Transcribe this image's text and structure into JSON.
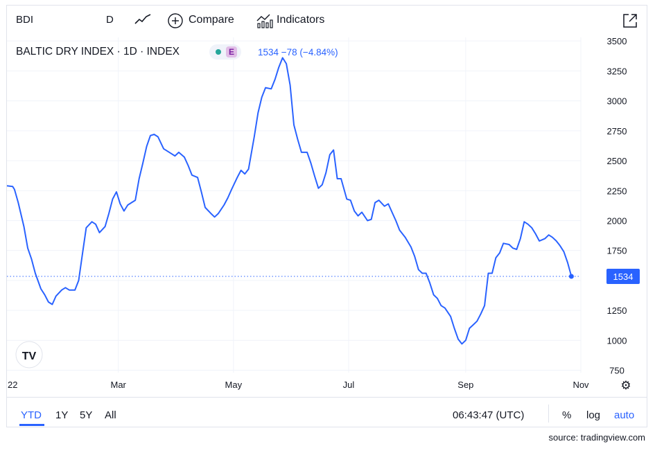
{
  "toolbar": {
    "symbol": "BDI",
    "interval": "D",
    "compare_label": "Compare",
    "indicators_label": "Indicators"
  },
  "legend": {
    "title": "BALTIC DRY INDEX · 1D · INDEX",
    "badge_letter": "E",
    "quote": "1534 −78 (−4.84%)"
  },
  "chart_data": {
    "type": "line",
    "title": "BALTIC DRY INDEX · 1D · INDEX",
    "xlabel": "",
    "ylabel": "",
    "ylim": [
      730,
      3530
    ],
    "y_ticks": [
      750,
      1000,
      1250,
      1500,
      1750,
      2000,
      2250,
      2500,
      2750,
      3000,
      3250,
      3500
    ],
    "x_tick_labels": [
      "22",
      "Mar",
      "May",
      "Jul",
      "Sep",
      "Nov"
    ],
    "x_tick_dates": [
      "2022-01-01",
      "2022-03-01",
      "2022-05-01",
      "2022-07-01",
      "2022-09-01",
      "2022-11-01"
    ],
    "x_range": [
      "2022-01-01",
      "2022-11-01"
    ],
    "last_value_label": "1534",
    "last_value": 1534,
    "color": "#2962ff",
    "grid": true,
    "series": [
      {
        "points": [
          [
            "2022-01-01",
            2290
          ],
          [
            "2022-01-04",
            2285
          ],
          [
            "2022-01-05",
            2260
          ],
          [
            "2022-01-07",
            2150
          ],
          [
            "2022-01-10",
            1950
          ],
          [
            "2022-01-12",
            1770
          ],
          [
            "2022-01-14",
            1680
          ],
          [
            "2022-01-16",
            1560
          ],
          [
            "2022-01-19",
            1430
          ],
          [
            "2022-01-21",
            1380
          ],
          [
            "2022-01-23",
            1320
          ],
          [
            "2022-01-25",
            1300
          ],
          [
            "2022-01-27",
            1370
          ],
          [
            "2022-01-30",
            1420
          ],
          [
            "2022-02-01",
            1440
          ],
          [
            "2022-02-03",
            1420
          ],
          [
            "2022-02-06",
            1420
          ],
          [
            "2022-02-08",
            1500
          ],
          [
            "2022-02-10",
            1720
          ],
          [
            "2022-02-12",
            1940
          ],
          [
            "2022-02-15",
            1990
          ],
          [
            "2022-02-17",
            1970
          ],
          [
            "2022-02-19",
            1900
          ],
          [
            "2022-02-22",
            1950
          ],
          [
            "2022-02-24",
            2060
          ],
          [
            "2022-02-26",
            2180
          ],
          [
            "2022-02-28",
            2240
          ],
          [
            "2022-03-02",
            2140
          ],
          [
            "2022-03-04",
            2080
          ],
          [
            "2022-03-06",
            2130
          ],
          [
            "2022-03-08",
            2150
          ],
          [
            "2022-03-10",
            2170
          ],
          [
            "2022-03-12",
            2350
          ],
          [
            "2022-03-14",
            2480
          ],
          [
            "2022-03-16",
            2620
          ],
          [
            "2022-03-18",
            2710
          ],
          [
            "2022-03-20",
            2720
          ],
          [
            "2022-03-22",
            2700
          ],
          [
            "2022-03-25",
            2600
          ],
          [
            "2022-03-27",
            2580
          ],
          [
            "2022-03-29",
            2560
          ],
          [
            "2022-03-31",
            2540
          ],
          [
            "2022-04-02",
            2570
          ],
          [
            "2022-04-05",
            2530
          ],
          [
            "2022-04-07",
            2460
          ],
          [
            "2022-04-09",
            2380
          ],
          [
            "2022-04-12",
            2360
          ],
          [
            "2022-04-14",
            2240
          ],
          [
            "2022-04-16",
            2110
          ],
          [
            "2022-04-19",
            2060
          ],
          [
            "2022-04-21",
            2030
          ],
          [
            "2022-04-23",
            2060
          ],
          [
            "2022-04-26",
            2130
          ],
          [
            "2022-04-28",
            2190
          ],
          [
            "2022-04-30",
            2260
          ],
          [
            "2022-05-03",
            2360
          ],
          [
            "2022-05-05",
            2420
          ],
          [
            "2022-05-07",
            2390
          ],
          [
            "2022-05-09",
            2430
          ],
          [
            "2022-05-12",
            2700
          ],
          [
            "2022-05-14",
            2900
          ],
          [
            "2022-05-16",
            3030
          ],
          [
            "2022-05-18",
            3110
          ],
          [
            "2022-05-21",
            3100
          ],
          [
            "2022-05-23",
            3180
          ],
          [
            "2022-05-25",
            3280
          ],
          [
            "2022-05-27",
            3360
          ],
          [
            "2022-05-29",
            3310
          ],
          [
            "2022-05-31",
            3130
          ],
          [
            "2022-06-02",
            2800
          ],
          [
            "2022-06-04",
            2680
          ],
          [
            "2022-06-06",
            2570
          ],
          [
            "2022-06-09",
            2570
          ],
          [
            "2022-06-11",
            2480
          ],
          [
            "2022-06-13",
            2370
          ],
          [
            "2022-06-15",
            2270
          ],
          [
            "2022-06-17",
            2300
          ],
          [
            "2022-06-19",
            2400
          ],
          [
            "2022-06-21",
            2550
          ],
          [
            "2022-06-23",
            2590
          ],
          [
            "2022-06-25",
            2350
          ],
          [
            "2022-06-27",
            2350
          ],
          [
            "2022-06-30",
            2180
          ],
          [
            "2022-07-02",
            2170
          ],
          [
            "2022-07-04",
            2080
          ],
          [
            "2022-07-06",
            2040
          ],
          [
            "2022-07-08",
            2070
          ],
          [
            "2022-07-11",
            2000
          ],
          [
            "2022-07-13",
            2010
          ],
          [
            "2022-07-15",
            2150
          ],
          [
            "2022-07-17",
            2170
          ],
          [
            "2022-07-20",
            2120
          ],
          [
            "2022-07-22",
            2140
          ],
          [
            "2022-07-24",
            2070
          ],
          [
            "2022-07-26",
            2000
          ],
          [
            "2022-07-28",
            1920
          ],
          [
            "2022-07-31",
            1860
          ],
          [
            "2022-08-03",
            1780
          ],
          [
            "2022-08-05",
            1700
          ],
          [
            "2022-08-07",
            1590
          ],
          [
            "2022-08-09",
            1560
          ],
          [
            "2022-08-11",
            1560
          ],
          [
            "2022-08-13",
            1480
          ],
          [
            "2022-08-15",
            1380
          ],
          [
            "2022-08-17",
            1350
          ],
          [
            "2022-08-19",
            1290
          ],
          [
            "2022-08-21",
            1270
          ],
          [
            "2022-08-24",
            1200
          ],
          [
            "2022-08-26",
            1100
          ],
          [
            "2022-08-28",
            1010
          ],
          [
            "2022-08-30",
            970
          ],
          [
            "2022-09-01",
            1000
          ],
          [
            "2022-09-03",
            1100
          ],
          [
            "2022-09-05",
            1130
          ],
          [
            "2022-09-07",
            1160
          ],
          [
            "2022-09-09",
            1220
          ],
          [
            "2022-09-11",
            1290
          ],
          [
            "2022-09-13",
            1560
          ],
          [
            "2022-09-15",
            1560
          ],
          [
            "2022-09-17",
            1690
          ],
          [
            "2022-09-19",
            1730
          ],
          [
            "2022-09-21",
            1810
          ],
          [
            "2022-09-24",
            1800
          ],
          [
            "2022-09-26",
            1770
          ],
          [
            "2022-09-28",
            1760
          ],
          [
            "2022-09-30",
            1850
          ],
          [
            "2022-10-02",
            1990
          ],
          [
            "2022-10-04",
            1970
          ],
          [
            "2022-10-06",
            1940
          ],
          [
            "2022-10-08",
            1890
          ],
          [
            "2022-10-10",
            1830
          ],
          [
            "2022-10-13",
            1850
          ],
          [
            "2022-10-15",
            1880
          ],
          [
            "2022-10-17",
            1860
          ],
          [
            "2022-10-19",
            1830
          ],
          [
            "2022-10-21",
            1790
          ],
          [
            "2022-10-23",
            1740
          ],
          [
            "2022-10-25",
            1650
          ],
          [
            "2022-10-27",
            1534
          ]
        ]
      }
    ]
  },
  "bottom_bar": {
    "ranges": [
      "YTD",
      "1Y",
      "5Y",
      "All"
    ],
    "active_range": "YTD",
    "time": "06:43:47 (UTC)",
    "percent_label": "%",
    "log_label": "log",
    "auto_label": "auto"
  },
  "source": "source: tradingview.com",
  "colors": {
    "accent": "#2962ff",
    "grid": "#f0f3fa",
    "text": "#131722"
  }
}
